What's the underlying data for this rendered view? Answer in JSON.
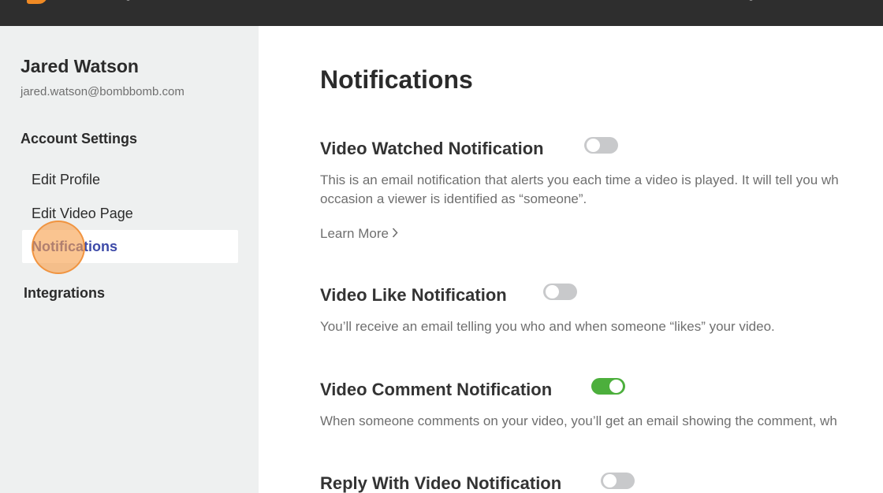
{
  "user": {
    "name": "Jared Watson",
    "email": "jared.watson@bombbomb.com"
  },
  "sidebar": {
    "section_title": "Account Settings",
    "items": [
      {
        "label": "Edit Profile",
        "active": false
      },
      {
        "label": "Edit Video Page",
        "active": false
      },
      {
        "label": "Notifications",
        "active": true
      }
    ],
    "integrations_label": "Integrations"
  },
  "main": {
    "title": "Notifications",
    "notifications": [
      {
        "title": "Video Watched Notification",
        "enabled": false,
        "description_lines": [
          "This is an email notification that alerts you each time a video is played. It will tell you wh",
          "occasion a viewer is identified as “someone”."
        ],
        "learn_more": "Learn More"
      },
      {
        "title": "Video Like Notification",
        "enabled": false,
        "description_lines": [
          "You’ll receive an email telling you who and when someone “likes” your video."
        ]
      },
      {
        "title": "Video Comment Notification",
        "enabled": true,
        "description_lines": [
          "When someone comments on your video, you’ll get an email showing the comment, wh"
        ]
      },
      {
        "title": "Reply With Video Notification",
        "enabled": false,
        "description_lines": []
      }
    ]
  },
  "colors": {
    "topbar": "#2e2e2e",
    "sidebar_bg": "#eef0f0",
    "active_nav_text": "#3d4aa8",
    "toggle_on": "#4caf3c",
    "toggle_off": "#c8c9cb",
    "logo_accent": "#f08a24",
    "click_marker": "#f7a04c"
  }
}
